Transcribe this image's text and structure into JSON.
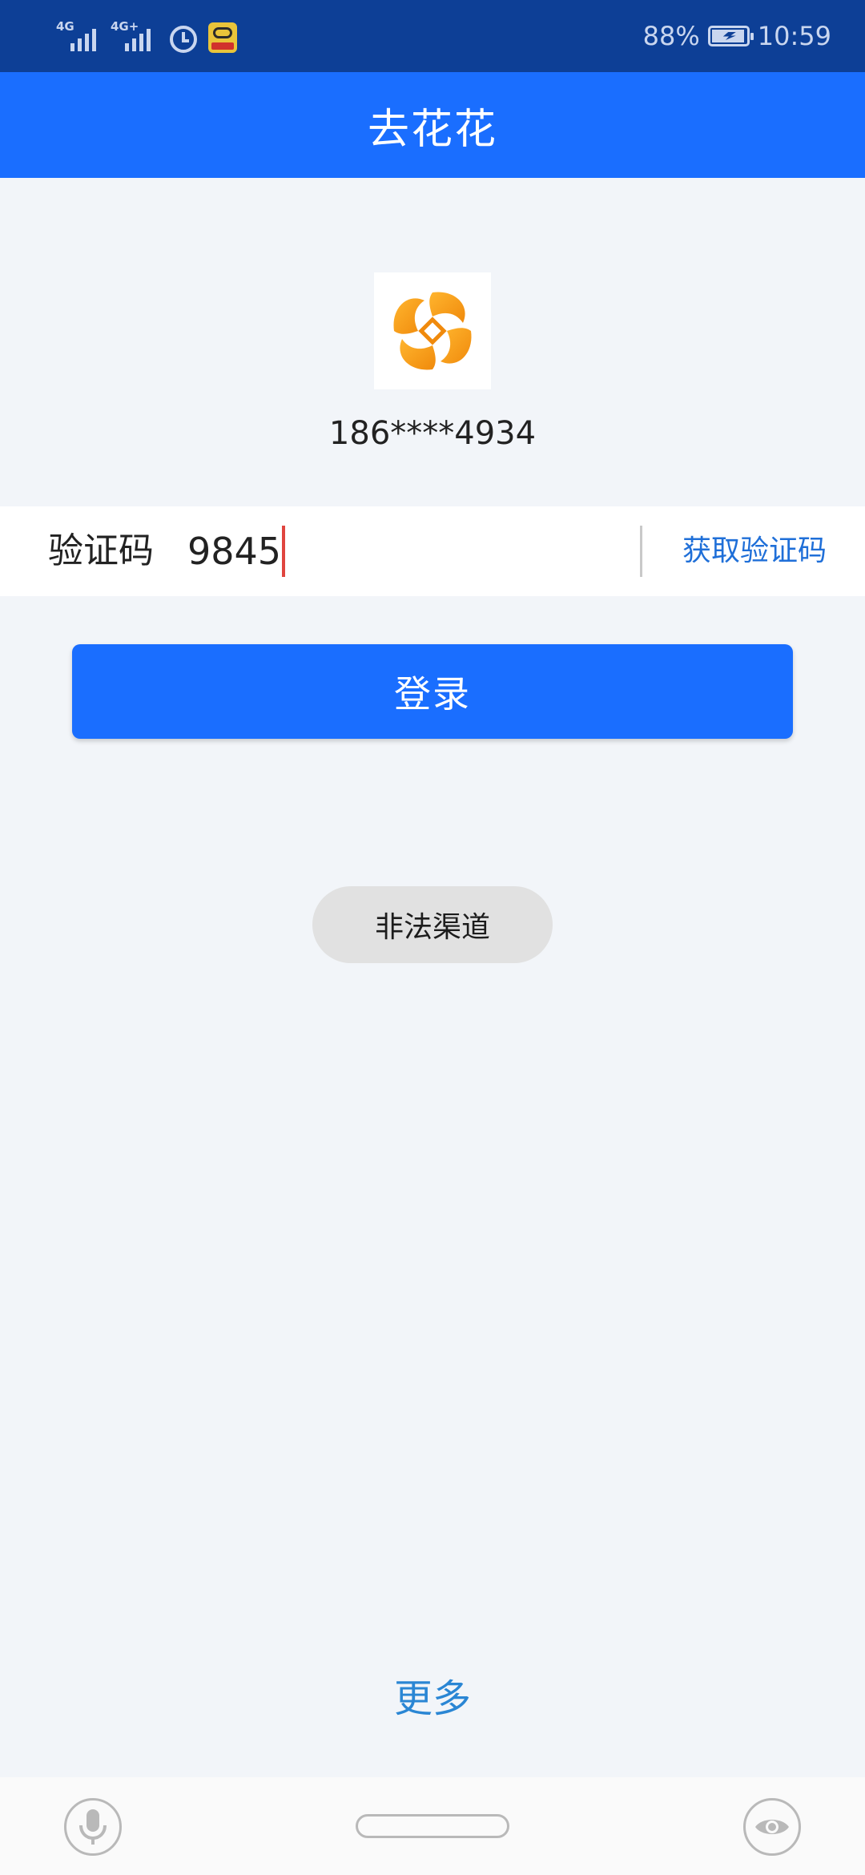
{
  "status_bar": {
    "network_1": "4G",
    "network_2": "4G+",
    "battery_percent": "88%",
    "time": "10:59",
    "icons": [
      "signal-icon",
      "signal-icon",
      "alarm-icon",
      "app-notification-icon",
      "battery-charging-icon"
    ]
  },
  "app_bar": {
    "title": "去花花"
  },
  "profile": {
    "logo_icon": "app-logo-icon",
    "phone": "186****4934"
  },
  "verification": {
    "label": "验证码",
    "value": "9845",
    "get_code_label": "获取验证码"
  },
  "login_button": {
    "label": "登录"
  },
  "toast": {
    "message": "非法渠道"
  },
  "more_link": {
    "label": "更多"
  },
  "nav_bar": {
    "icons": [
      "microphone-icon",
      "home-handle",
      "eye-icon"
    ]
  },
  "colors": {
    "status_bar": "#0d3f96",
    "primary": "#1a6eff",
    "background": "#f2f5f9",
    "link": "#1f6fd8",
    "caret": "#e0453f",
    "logo_orange": "#f7a21b"
  }
}
